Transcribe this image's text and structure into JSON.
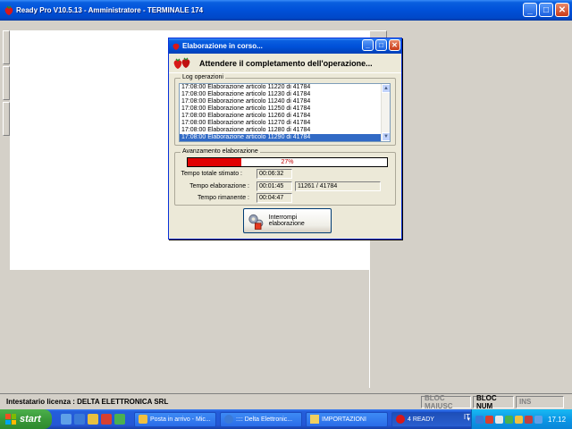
{
  "app": {
    "title": "Ready Pro V10.5.13 - Amministratore - TERMINALE 174",
    "min": "_",
    "max": "□",
    "close": "✕"
  },
  "dialog": {
    "title": "Elaborazione in corso...",
    "heading": "Attendere il completamento dell'operazione...",
    "min": "_",
    "max": "□",
    "close": "✕",
    "log_label": "Log operazioni",
    "log": [
      "17:08:00 Elaborazione articolo 11220 di 41784",
      "17:08:00 Elaborazione articolo 11230 di 41784",
      "17:08:00 Elaborazione articolo 11240 di 41784",
      "17:08:00 Elaborazione articolo 11250 di 41784",
      "17:08:00 Elaborazione articolo 11260 di 41784",
      "17:08:00 Elaborazione articolo 11270 di 41784",
      "17:08:00 Elaborazione articolo 11280 di 41784",
      "17:08:00 Elaborazione articolo 11290 di 41784"
    ],
    "progress_label": "Avanzamento elaborazione",
    "progress_percent": 27,
    "progress_text": "27%",
    "total_time_label": "Tempo totale stimato :",
    "total_time": "00:06:32",
    "elapsed_label": "Tempo elaborazione :",
    "elapsed": "00:01:45",
    "count": "11261 / 41784",
    "remaining_label": "Tempo rimanente :",
    "remaining": "00:04:47",
    "stop_button": "Interrompi elaborazione"
  },
  "statusbar": {
    "license": "Intestatario licenza : DELTA ELETTRONICA SRL",
    "caps": "BLOC MAIUSC",
    "num": "BLOC NUM",
    "ins": "INS"
  },
  "taskbar": {
    "start": "start",
    "tasks": [
      "Posta in arrivo - Mic...",
      ":::: Delta Elettronic...",
      "IMPORTAZIONI",
      "4 READY"
    ],
    "language": "IT",
    "clock": "17.12"
  },
  "colors": {
    "accent": "#0050d8",
    "progress": "#e00000",
    "selection": "#316ac5"
  }
}
